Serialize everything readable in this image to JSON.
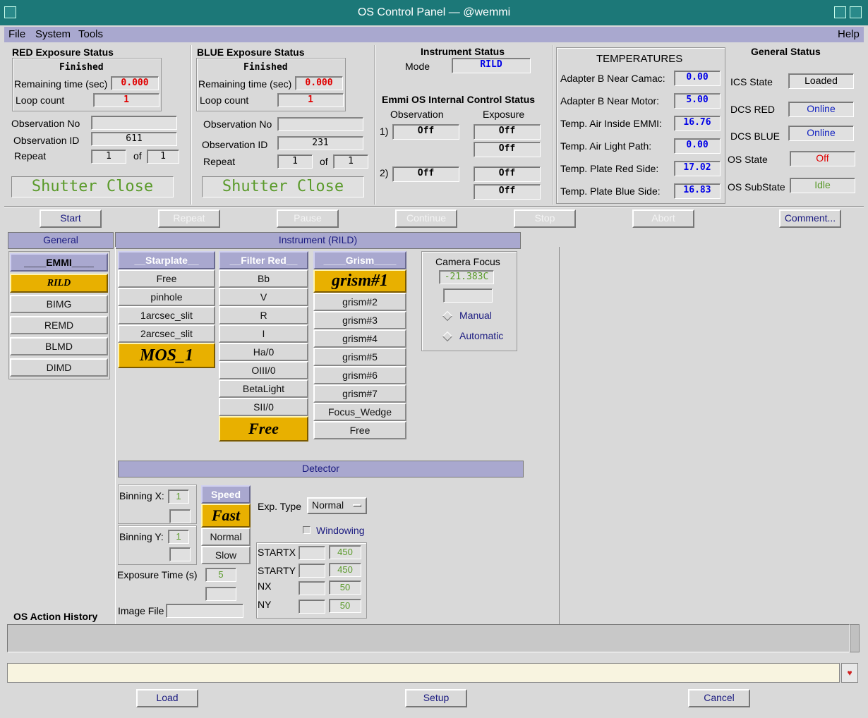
{
  "window": {
    "title": "OS Control Panel — @wemmi"
  },
  "menu": {
    "file": "File",
    "system": "System",
    "tools": "Tools",
    "help": "Help"
  },
  "red": {
    "title": "RED Exposure Status",
    "state": "Finished",
    "remaining_label": "Remaining time (sec)",
    "remaining": "0.000",
    "loop_label": "Loop count",
    "loop": "1",
    "obs_no_label": "Observation No",
    "obs_no": "",
    "obs_id_label": "Observation ID",
    "obs_id": "611",
    "repeat_label": "Repeat",
    "repeat": "1",
    "of_label": "of",
    "repeat_of": "1",
    "shutter": "Shutter Close"
  },
  "blue": {
    "title": "BLUE Exposure Status",
    "state": "Finished",
    "remaining_label": "Remaining time (sec)",
    "remaining": "0.000",
    "loop_label": "Loop count",
    "loop": "1",
    "obs_no_label": "Observation No",
    "obs_no": "",
    "obs_id_label": "Observation ID",
    "obs_id": "231",
    "repeat_label": "Repeat",
    "repeat": "1",
    "of_label": "of",
    "repeat_of": "1",
    "shutter": "Shutter Close"
  },
  "instrument": {
    "title": "Instrument Status",
    "mode_label": "Mode",
    "mode": "RILD",
    "internal_title": "Emmi OS Internal Control Status",
    "observation_label": "Observation",
    "exposure_label": "Exposure",
    "row1": "1)",
    "row2": "2)",
    "obs1": "Off",
    "exp1a": "Off",
    "exp1b": "Off",
    "obs2": "Off",
    "exp2a": "Off",
    "exp2b": "Off"
  },
  "temps": {
    "title": "TEMPERATURES",
    "items": [
      {
        "label": "Adapter B Near Camac:",
        "value": "0.00"
      },
      {
        "label": "Adapter B Near Motor:",
        "value": "5.00"
      },
      {
        "label": "Temp. Air Inside EMMI:",
        "value": "16.76"
      },
      {
        "label": "Temp. Air Light Path:",
        "value": "0.00"
      },
      {
        "label": "Temp. Plate Red Side:",
        "value": "17.02"
      },
      {
        "label": "Temp. Plate Blue Side:",
        "value": "16.83"
      }
    ]
  },
  "general_status": {
    "title": "General Status",
    "ics_label": "ICS State",
    "ics": "Loaded",
    "dcs_red_label": "DCS RED",
    "dcs_red": "Online",
    "dcs_blue_label": "DCS BLUE",
    "dcs_blue": "Online",
    "os_state_label": "OS State",
    "os_state": "Off",
    "os_sub_label": "OS SubState",
    "os_sub": "Idle",
    "colors": {
      "online": "#1020c0",
      "off": "#e00000",
      "idle": "#5a9a2a"
    }
  },
  "actions": {
    "start": "Start",
    "repeat": "Repeat",
    "pause": "Pause",
    "continue": "Continue",
    "stop": "Stop",
    "abort": "Abort",
    "comment": "Comment..."
  },
  "tabs": {
    "general": "General",
    "instrument": "Instrument (RILD)"
  },
  "modes": {
    "header": "____EMMI____",
    "items": [
      "RILD",
      "BIMG",
      "REMD",
      "BLMD",
      "DIMD"
    ],
    "selected": "RILD"
  },
  "starplate": {
    "header": "__Starplate__",
    "items": [
      "Free",
      "pinhole",
      "1arcsec_slit",
      "2arcsec_slit"
    ],
    "selected": "MOS_1"
  },
  "filter_red": {
    "header": "__Filter Red__",
    "items": [
      "Bb",
      "V",
      "R",
      "I",
      "Ha/0",
      "OIII/0",
      "BetaLight",
      "SII/0"
    ],
    "selected": "Free"
  },
  "grism": {
    "header": "____Grism____",
    "selected": "grism#1",
    "items": [
      "grism#2",
      "grism#3",
      "grism#4",
      "grism#5",
      "grism#6",
      "grism#7",
      "Focus_Wedge",
      "Free"
    ]
  },
  "camera_focus": {
    "title": "Camera Focus",
    "value": "-21.383C",
    "input": "",
    "manual": "Manual",
    "automatic": "Automatic"
  },
  "detector": {
    "header": "Detector",
    "binx_label": "Binning X:",
    "binx": "1",
    "biny_label": "Binning Y:",
    "biny": "1",
    "speed_header": "Speed",
    "speed_selected": "Fast",
    "speed_normal": "Normal",
    "speed_slow": "Slow",
    "exp_type_label": "Exp. Type",
    "exp_type": "Normal",
    "windowing": "Windowing",
    "startx_label": "STARTX",
    "startx": "450",
    "starty_label": "STARTY",
    "starty": "450",
    "nx_label": "NX",
    "nx": "50",
    "ny_label": "NY",
    "ny": "50",
    "exp_time_label": "Exposure Time (s)",
    "exp_time": "5",
    "image_file_label": "Image File",
    "image_file": ""
  },
  "history": {
    "title": "OS Action History"
  },
  "bottom": {
    "load": "Load",
    "setup": "Setup",
    "cancel": "Cancel"
  }
}
